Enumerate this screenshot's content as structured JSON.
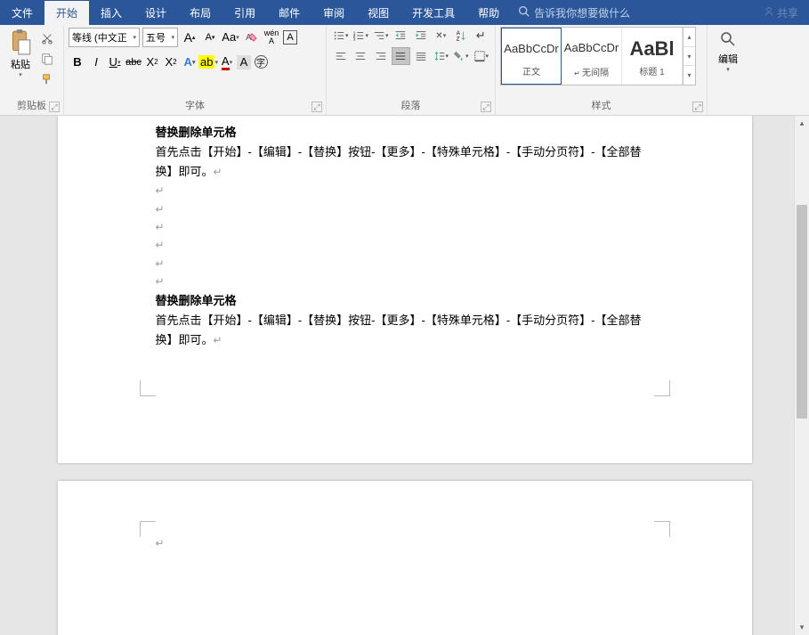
{
  "tabs": {
    "file": "文件",
    "home": "开始",
    "insert": "插入",
    "design": "设计",
    "layout": "布局",
    "references": "引用",
    "mail": "邮件",
    "review": "审阅",
    "view": "视图",
    "developer": "开发工具",
    "help": "帮助"
  },
  "tellme": "告诉我你想要做什么",
  "share": "共享",
  "ribbon": {
    "clipboard": {
      "label": "剪贴板",
      "paste": "粘贴"
    },
    "font": {
      "label": "字体",
      "name": "等线 (中文正",
      "size": "五号",
      "wen": "wén"
    },
    "paragraph": {
      "label": "段落"
    },
    "styles": {
      "label": "样式",
      "items": [
        {
          "preview": "AaBbCcDr",
          "name": "正文"
        },
        {
          "preview": "AaBbCcDr",
          "name": "无间隔"
        },
        {
          "preview": "AaBl",
          "name": "标题 1"
        }
      ]
    },
    "editing": {
      "label": "编辑"
    }
  },
  "document": {
    "heading1": "替换删除单元格",
    "body1": "首先点击【开始】-【编辑】-【替换】按钮-【更多】-【特殊单元格】-【手动分页符】-【全部替换】即可。",
    "heading2": "替换删除单元格",
    "body2": "首先点击【开始】-【编辑】-【替换】按钮-【更多】-【特殊单元格】-【手动分页符】-【全部替换】即可。",
    "pmark": "↵"
  }
}
